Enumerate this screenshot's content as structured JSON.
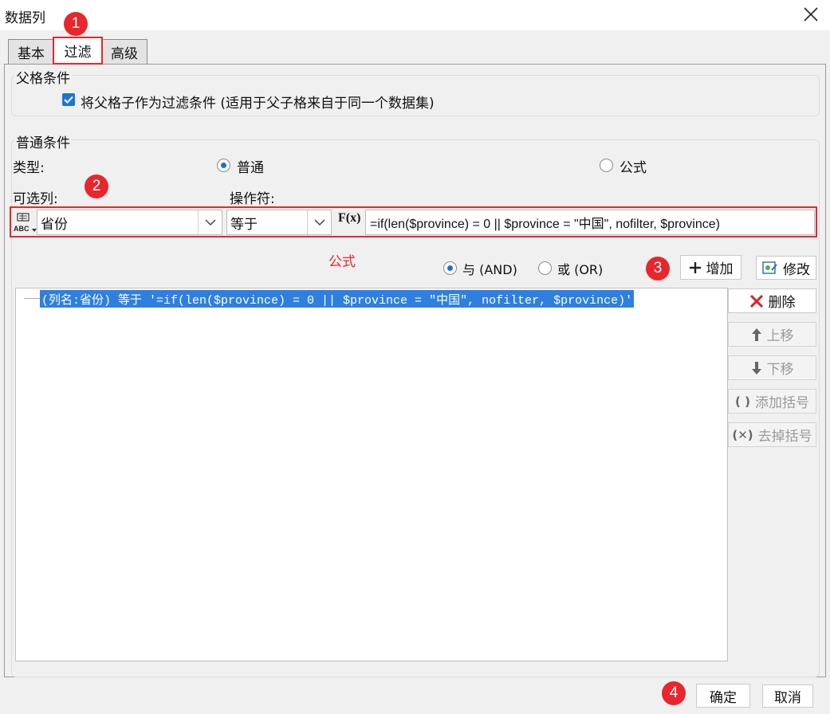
{
  "window": {
    "title": "数据列"
  },
  "tabs": [
    {
      "label": "基本"
    },
    {
      "label": "过滤"
    },
    {
      "label": "高级"
    }
  ],
  "parent_condition": {
    "legend": "父格条件",
    "checkbox_label": "将父格子作为过滤条件 (适用于父子格来自于同一个数据集)",
    "checked": true
  },
  "normal_condition": {
    "legend": "普通条件",
    "type_label": "类型:",
    "type_options": [
      {
        "label": "普通",
        "selected": true
      },
      {
        "label": "公式",
        "selected": false
      }
    ],
    "column_label": "可选列:",
    "operator_label": "操作符:",
    "column_value": "省份",
    "operator_value": "等于",
    "formula_button_label": "F(x)",
    "formula_value": "=if(len($province) = 0 || $province = \"中国\", nofilter, $province)",
    "formula_annotation": "公式"
  },
  "logic": {
    "and_label": "与 (AND)",
    "or_label": "或 (OR)",
    "selected": "and"
  },
  "actions": {
    "add": "增加",
    "modify": "修改",
    "delete": "删除",
    "move_up": "上移",
    "move_down": "下移",
    "add_bracket": "添加括号",
    "remove_bracket": "去掉括号"
  },
  "condition_list": [
    "(列名:省份) 等于 '=if(len($province) = 0 || $province = \"中国\", nofilter, $province)'"
  ],
  "footer": {
    "ok": "确定",
    "cancel": "取消"
  },
  "annotations": {
    "badge_1": "1",
    "badge_2": "2",
    "badge_3": "3",
    "badge_4": "4"
  },
  "colors": {
    "highlight": "#2f7fe0",
    "annotation_red": "#e8262b",
    "check_blue": "#1e74d6"
  }
}
